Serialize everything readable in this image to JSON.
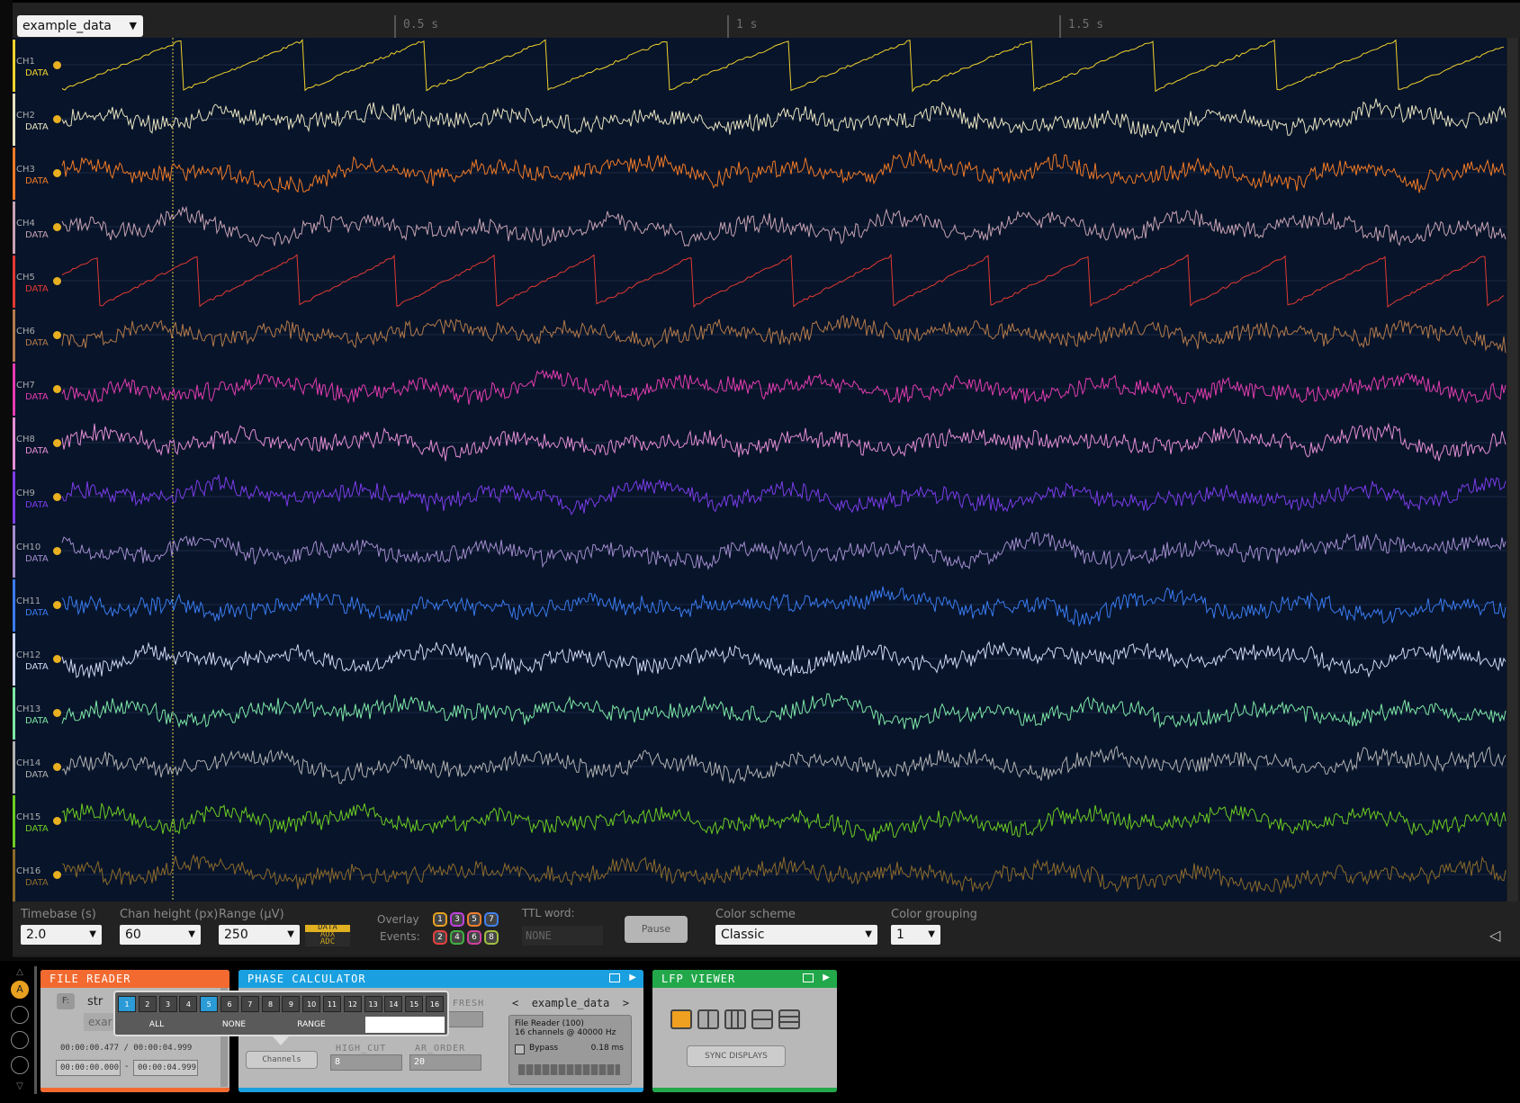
{
  "source": {
    "selected": "example_data"
  },
  "timeline": {
    "ticks": [
      "0.5 s",
      "1 s",
      "1.5 s"
    ]
  },
  "channels": [
    {
      "name": "CH1",
      "type": "DATA",
      "color": "#f2d22c",
      "kind": "saw"
    },
    {
      "name": "CH2",
      "type": "DATA",
      "color": "#e8e3c0",
      "kind": "noise"
    },
    {
      "name": "CH3",
      "type": "DATA",
      "color": "#f07a26",
      "kind": "noise"
    },
    {
      "name": "CH4",
      "type": "DATA",
      "color": "#c7a2b2",
      "kind": "noise"
    },
    {
      "name": "CH5",
      "type": "DATA",
      "color": "#e23a32",
      "kind": "saw"
    },
    {
      "name": "CH6",
      "type": "DATA",
      "color": "#b47a4a",
      "kind": "noise"
    },
    {
      "name": "CH7",
      "type": "DATA",
      "color": "#e33cb0",
      "kind": "noise"
    },
    {
      "name": "CH8",
      "type": "DATA",
      "color": "#e48ed4",
      "kind": "noise"
    },
    {
      "name": "CH9",
      "type": "DATA",
      "color": "#7b3ce8",
      "kind": "noise"
    },
    {
      "name": "CH10",
      "type": "DATA",
      "color": "#a28ccc",
      "kind": "noise"
    },
    {
      "name": "CH11",
      "type": "DATA",
      "color": "#3a7bf0",
      "kind": "noise"
    },
    {
      "name": "CH12",
      "type": "DATA",
      "color": "#cfd6f2",
      "kind": "noise"
    },
    {
      "name": "CH13",
      "type": "DATA",
      "color": "#7ee8a6",
      "kind": "noise"
    },
    {
      "name": "CH14",
      "type": "DATA",
      "color": "#b0b0b0",
      "kind": "noise"
    },
    {
      "name": "CH15",
      "type": "DATA",
      "color": "#6ccc22",
      "kind": "noise"
    },
    {
      "name": "CH16",
      "type": "DATA",
      "color": "#8c6a2a",
      "kind": "noise"
    }
  ],
  "controls": {
    "timebase": {
      "label": "Timebase (s)",
      "value": "2.0"
    },
    "chan_height": {
      "label": "Chan height (px)",
      "value": "60"
    },
    "range": {
      "label": "Range (µV)",
      "value": "250"
    },
    "display_modes": [
      "DATA",
      "AUX",
      "ADC"
    ],
    "overlay_label_1": "Overlay",
    "overlay_label_2": "Events:",
    "events_top": [
      "1",
      "3",
      "5",
      "7"
    ],
    "events_bottom": [
      "2",
      "4",
      "6",
      "8"
    ],
    "ttl_label": "TTL word:",
    "ttl_value": "NONE",
    "pause": "Pause",
    "color_scheme": {
      "label": "Color scheme",
      "value": "Classic"
    },
    "color_grouping": {
      "label": "Color grouping",
      "value": "1"
    }
  },
  "file_reader": {
    "title": "FILE READER",
    "file_label": "F:",
    "stream_text": "str",
    "file_text": "exar",
    "time_current": "00:00:00.477",
    "time_sep": "/",
    "time_total": "00:00:04.999",
    "start": "00:00:00.000",
    "range_sep": "-",
    "end": "00:00:04.999"
  },
  "channel_popup": {
    "channels": [
      "1",
      "2",
      "3",
      "4",
      "5",
      "6",
      "7",
      "8",
      "9",
      "10",
      "11",
      "12",
      "13",
      "14",
      "15",
      "16"
    ],
    "selected": [
      1,
      5
    ],
    "all": "ALL",
    "none": "NONE",
    "range": "RANGE"
  },
  "phase_calculator": {
    "title": "PHASE CALCULATOR",
    "refresh_label": "FRESH",
    "stream_prev": "<",
    "stream_name": "example_data",
    "stream_next": ">",
    "stream_info_1": "File Reader (100)",
    "stream_info_2": "16 channels @ 40000 Hz",
    "bypass": "Bypass",
    "latency": "0.18 ms",
    "channels_button": "Channels",
    "high_cut_label": "HIGH_CUT",
    "high_cut": "8",
    "ar_order_label": "AR_ORDER",
    "ar_order": "20"
  },
  "lfp_viewer": {
    "title": "LFP VIEWER",
    "sync": "SYNC DISPLAYS"
  },
  "sidebar": {
    "active": "A"
  }
}
